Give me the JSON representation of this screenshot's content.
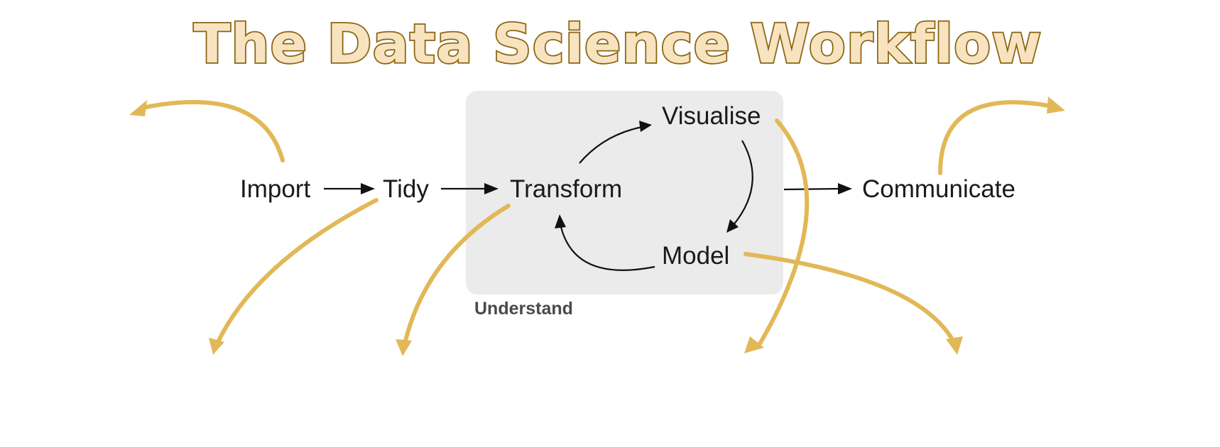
{
  "title": "The Data Science Workflow",
  "nodes": {
    "import": "Import",
    "tidy": "Tidy",
    "transform": "Transform",
    "visualise": "Visualise",
    "model": "Model",
    "communicate": "Communicate"
  },
  "group": {
    "label": "Understand",
    "background_color": "#ebebeb"
  },
  "colors": {
    "title_fill": "#f7e3c0",
    "title_outline": "#8a6410",
    "flow_arrow": "#111111",
    "highlight_arrow": "#e2b857"
  }
}
